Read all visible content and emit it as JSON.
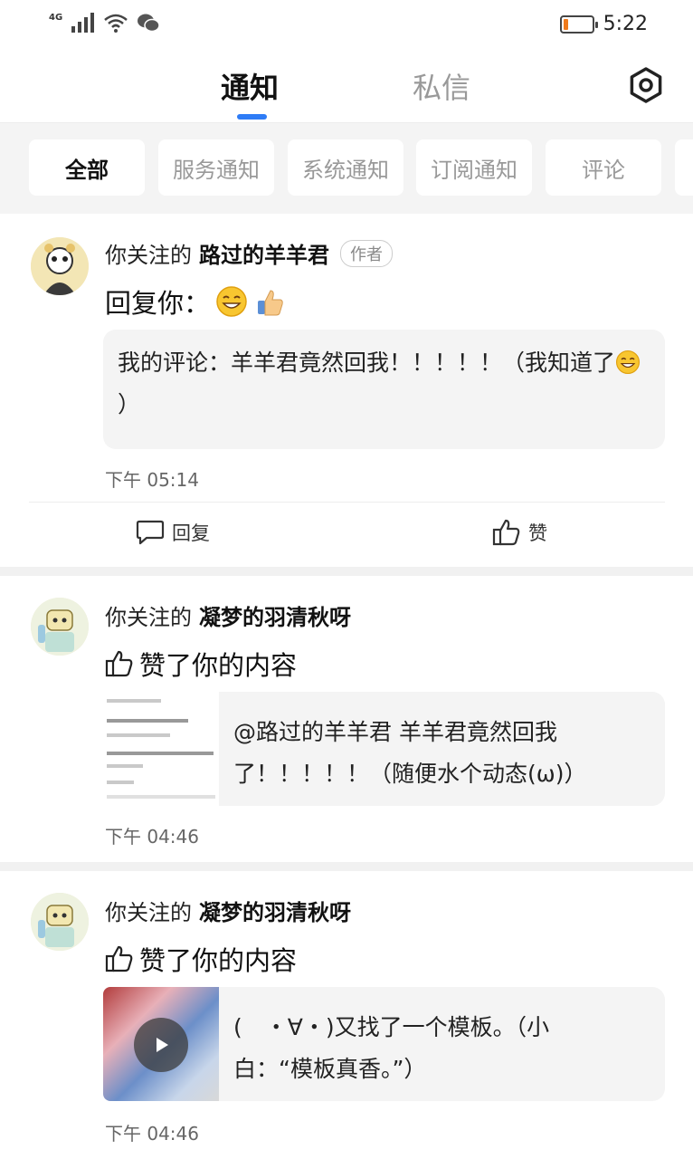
{
  "status_bar": {
    "network": "4G",
    "time": "5:22",
    "battery_level": 0.15
  },
  "top_tabs": {
    "notifications": "通知",
    "messages": "私信"
  },
  "filters": [
    "全部",
    "服务通知",
    "系统通知",
    "订阅通知",
    "评论"
  ],
  "colors": {
    "accent": "#2e7cf6",
    "battery_low": "#f07a1a"
  },
  "cards": [
    {
      "prefix": "你关注的",
      "user": "路过的羊羊君",
      "tag": "作者",
      "action": "回复你：",
      "quote": "我的评论：羊羊君竟然回我！！！！！（我知道了",
      "quote_end": "）",
      "time": "下午 05:14",
      "reply_label": "回复",
      "like_label": "赞"
    },
    {
      "prefix": "你关注的",
      "user": "凝梦的羽清秋呀",
      "action": "赞了你的内容",
      "quote": "@路过的羊羊君 羊羊君竟然回我了！！！！！（随便水个动态(ω)）",
      "time": "下午 04:46"
    },
    {
      "prefix": "你关注的",
      "user": "凝梦的羽清秋呀",
      "action": "赞了你的内容",
      "quote": "(　・∀・)又找了一个模板。（小白：“模板真香。”）",
      "time": "下午 04:46"
    }
  ]
}
